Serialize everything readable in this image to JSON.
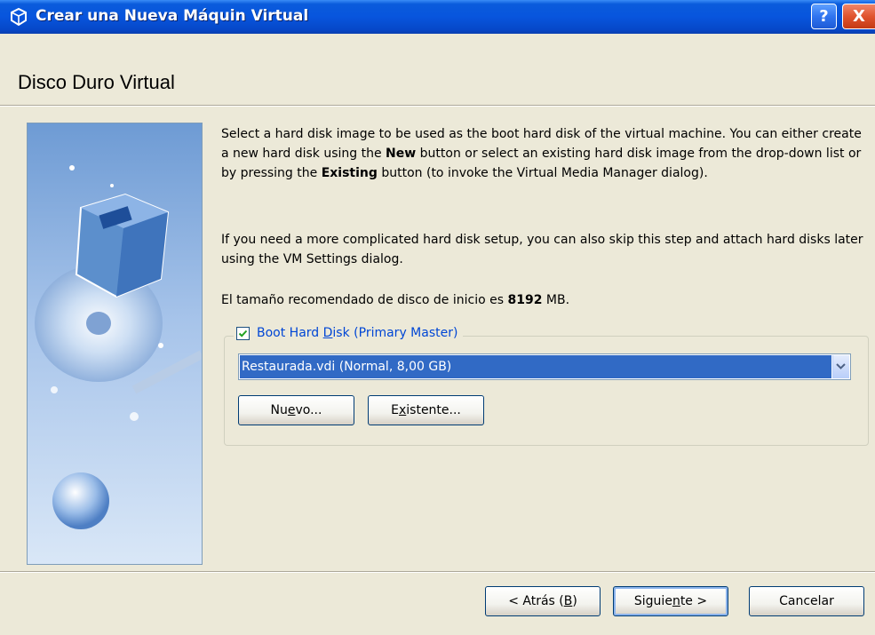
{
  "window": {
    "title": "Crear una Nueva Máquin Virtual",
    "help_label": "?",
    "close_label": "X"
  },
  "header": {
    "title": "Disco Duro Virtual"
  },
  "description": {
    "p1_a": "Select a hard disk image to be used as the boot hard disk of the virtual machine. You can either create a new hard disk using the ",
    "p1_b": "New",
    "p1_c": " button or select an existing hard disk image from the drop-down list or by pressing the ",
    "p1_d": "Existing",
    "p1_e": " button (to invoke the Virtual Media Manager dialog).",
    "p2": "If you need a more complicated hard disk setup, you can also skip this step and attach hard disks later using the VM Settings dialog.",
    "p3_a": "El tamaño recomendado de disco de inicio es ",
    "p3_b": "8192",
    "p3_c": " MB."
  },
  "boot_disk": {
    "label_pre": "Boot Hard ",
    "label_ul": "D",
    "label_post": "isk (Primary Master)",
    "checked": true,
    "selected_value": "Restaurada.vdi (Normal, 8,00 GB)",
    "nuevo_pre": "Nu",
    "nuevo_ul": "e",
    "nuevo_post": "vo...",
    "existente_pre": "E",
    "existente_ul": "x",
    "existente_post": "istente..."
  },
  "footer": {
    "back_pre": "< Atrás (",
    "back_ul": "B",
    "back_post": ")",
    "next_pre": "Siguie",
    "next_ul": "n",
    "next_post": "te >",
    "cancel": "Cancelar"
  },
  "colors": {
    "titlebar": "#0855DD",
    "dialog_bg": "#ECE9D8",
    "selection": "#316AC5",
    "group_label": "#0046D5"
  },
  "icons": {
    "app": "virtualbox-icon",
    "dropdown": "chevron-down-icon",
    "check": "checkmark-icon"
  }
}
